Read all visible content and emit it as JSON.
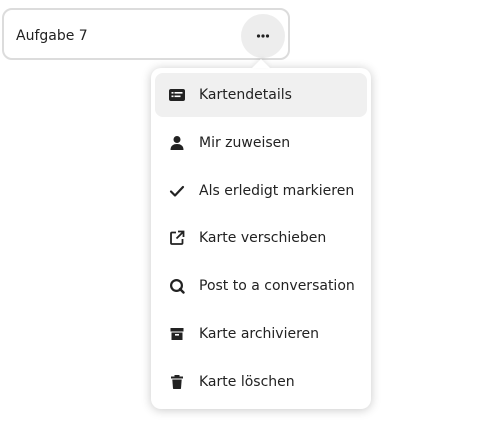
{
  "card": {
    "title": "Aufgabe 7",
    "more_button_icon": "more-horizontal-icon"
  },
  "menu": {
    "items": [
      {
        "label": "Kartendetails",
        "icon": "card-details-icon",
        "active": true
      },
      {
        "label": "Mir zuweisen",
        "icon": "user-icon",
        "active": false
      },
      {
        "label": "Als erledigt markieren",
        "icon": "check-icon",
        "active": false
      },
      {
        "label": "Karte verschieben",
        "icon": "open-in-new-icon",
        "active": false
      },
      {
        "label": "Post to a conversation",
        "icon": "talk-icon",
        "active": false
      },
      {
        "label": "Karte archivieren",
        "icon": "archive-icon",
        "active": false
      },
      {
        "label": "Karte löschen",
        "icon": "delete-icon",
        "active": false
      }
    ]
  },
  "colors": {
    "text": "#222222",
    "active_item_bg": "#f0f0f0",
    "card_border": "#dcdcdc",
    "button_bg": "#ededed"
  }
}
